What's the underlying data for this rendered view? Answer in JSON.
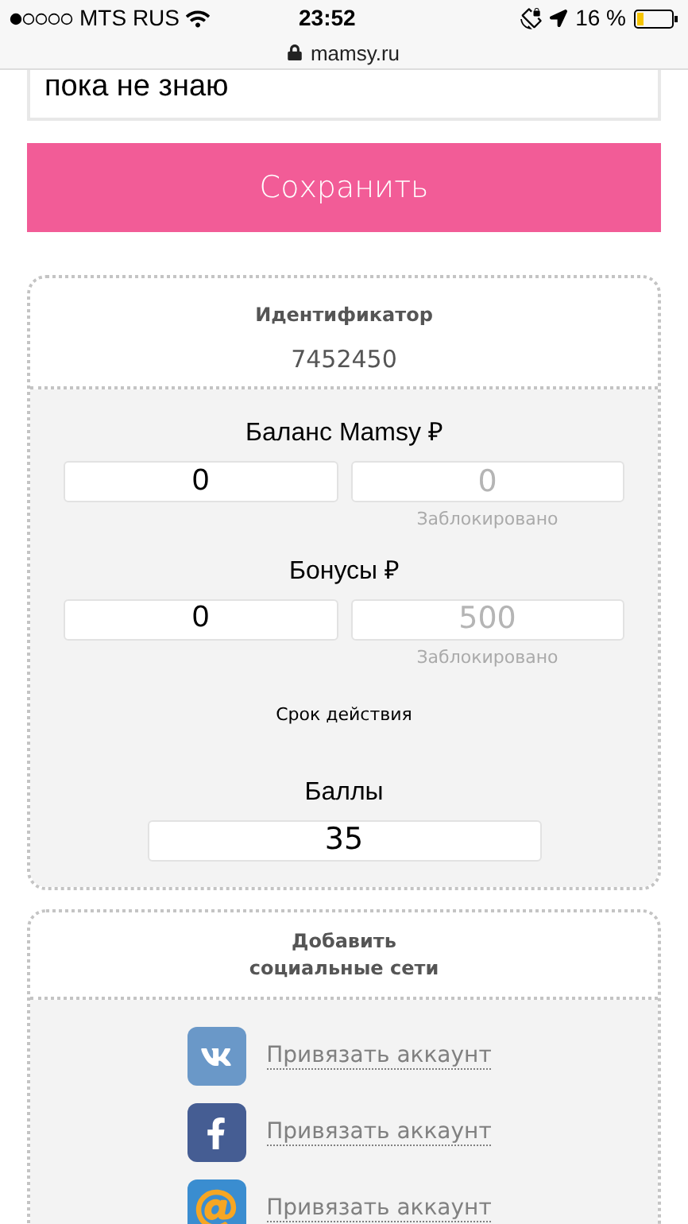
{
  "status_bar": {
    "carrier": "MTS RUS",
    "time": "23:52",
    "battery": "16 %",
    "url": "mamsy.ru"
  },
  "top_field": {
    "value": "пока не знаю"
  },
  "save_button": {
    "label": "Сохранить"
  },
  "identifier": {
    "label": "Идентификатор",
    "value": "7452450"
  },
  "balances": [
    {
      "title": "Баланс Mamsy ₽",
      "fields": [
        {
          "value": "0",
          "disabled": false
        },
        {
          "value": "0",
          "disabled": true,
          "note": "Заблокировано"
        }
      ]
    },
    {
      "title": "Бонусы ₽",
      "fields": [
        {
          "value": "0",
          "disabled": false
        },
        {
          "value": "500",
          "disabled": true,
          "note": "Заблокировано"
        }
      ]
    }
  ],
  "expiry_label": "Срок действия",
  "points": {
    "title": "Баллы",
    "value": "35"
  },
  "social": {
    "title": "Добавить\nсоциальные сети",
    "items": [
      {
        "kind": "vk",
        "link": "Привязать аккаунт"
      },
      {
        "kind": "facebook",
        "link": "Привязать аккаунт"
      },
      {
        "kind": "mail",
        "link": "Привязать аккаунт"
      }
    ]
  }
}
